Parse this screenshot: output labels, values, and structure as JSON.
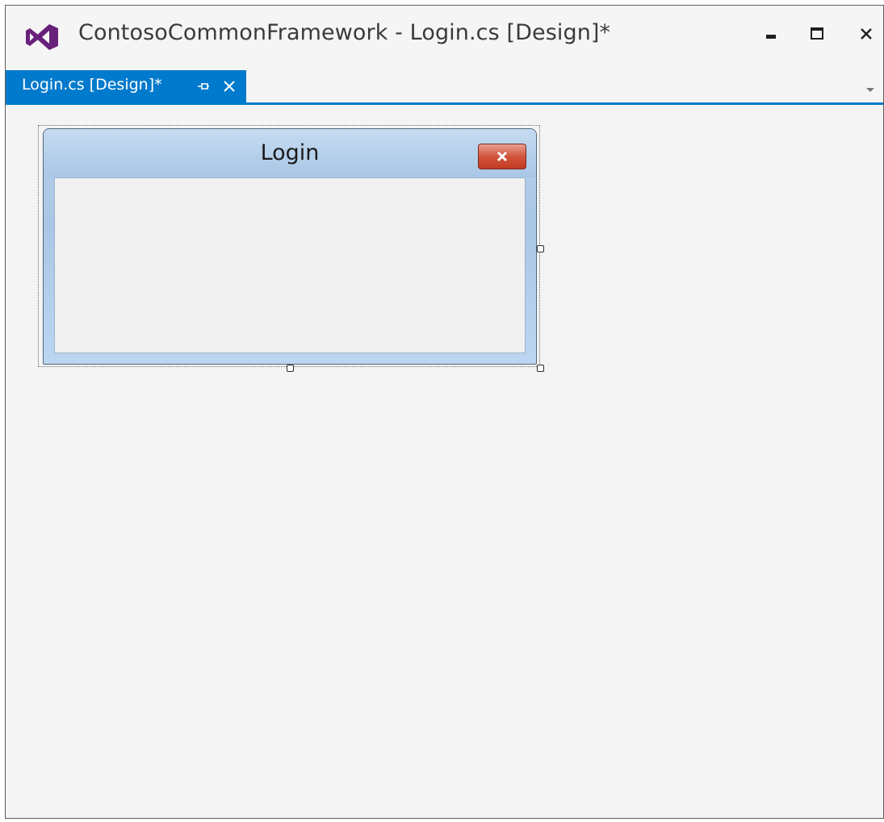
{
  "window": {
    "title": "ContosoCommonFramework - Login.cs [Design]*",
    "logo_icon": "visual-studio-icon",
    "controls": {
      "minimize_icon": "minimize-icon",
      "maximize_icon": "maximize-icon",
      "close_icon": "close-icon"
    }
  },
  "tabstrip": {
    "active_tab": {
      "label": "Login.cs [Design]*",
      "pin_icon": "pin-icon",
      "close_icon": "close-icon"
    },
    "dropdown_icon": "chevron-down-icon",
    "accent_color": "#007acc"
  },
  "designer": {
    "form": {
      "title": "Login",
      "close_icon": "close-icon"
    }
  }
}
